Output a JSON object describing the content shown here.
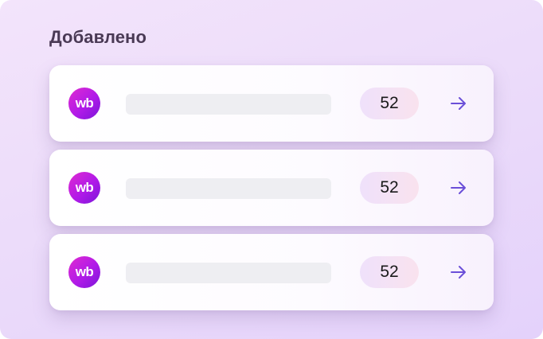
{
  "section": {
    "title": "Добавлено"
  },
  "items": [
    {
      "logo_text": "wb",
      "count": "52",
      "arrow_icon": "arrow-right-icon"
    },
    {
      "logo_text": "wb",
      "count": "52",
      "arrow_icon": "arrow-right-icon"
    },
    {
      "logo_text": "wb",
      "count": "52",
      "arrow_icon": "arrow-right-icon"
    }
  ],
  "colors": {
    "accent": "#6b4fd8",
    "logo_gradient_start": "#e02bd0",
    "logo_gradient_end": "#7a16d8",
    "placeholder_bar": "#eeeef2"
  }
}
